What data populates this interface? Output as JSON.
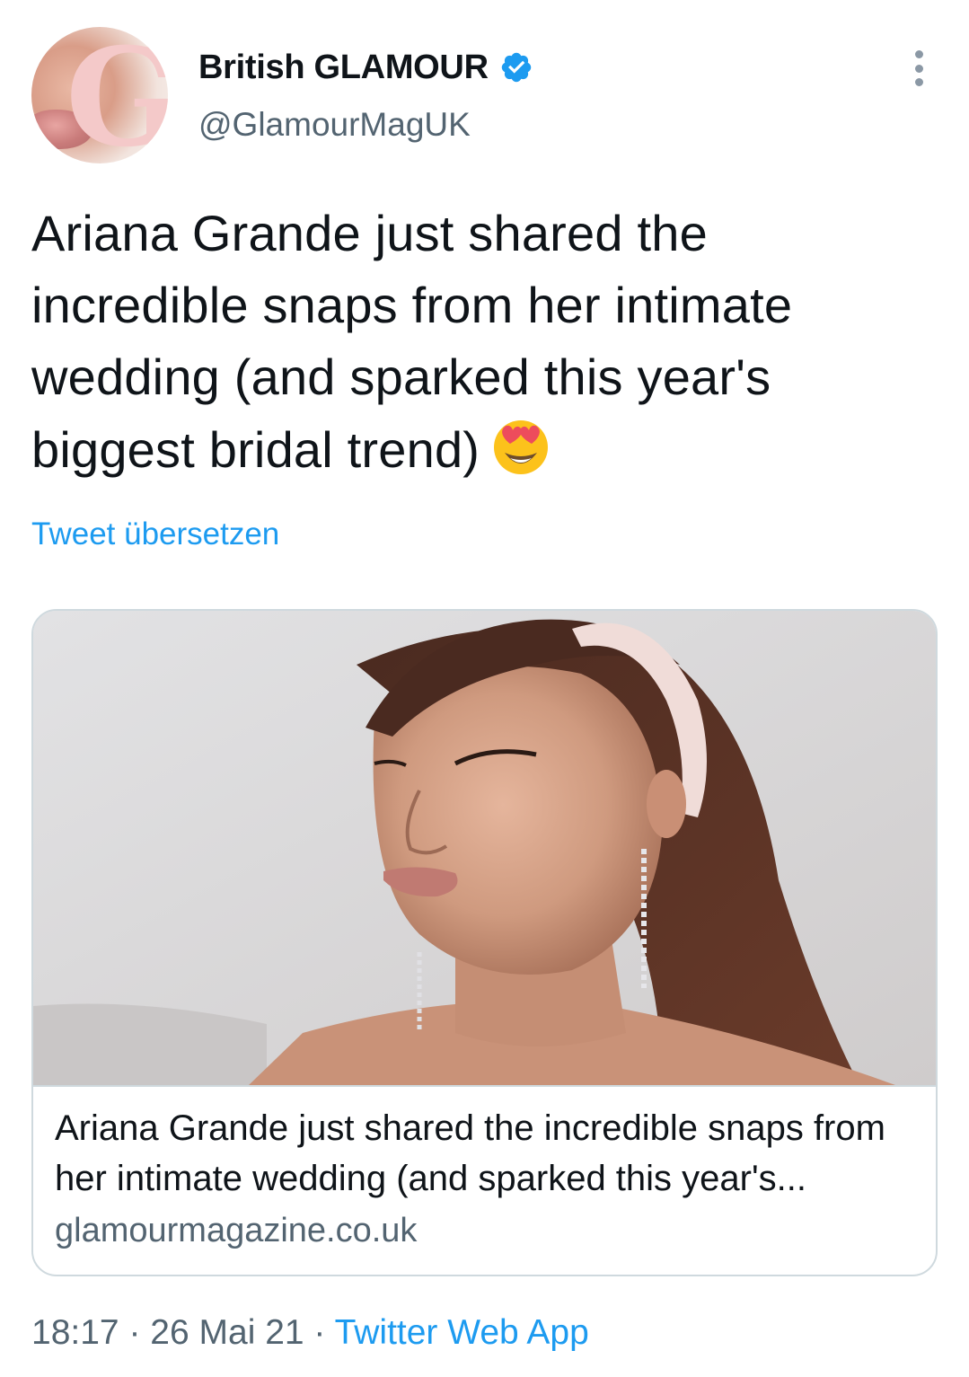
{
  "author": {
    "display_name": "British GLAMOUR",
    "handle": "@GlamourMagUK",
    "avatar_letter": "G",
    "verified": true
  },
  "tweet": {
    "text": "Ariana Grande just shared the incredible snaps from her intimate wedding (and sparked this year's biggest bridal trend)",
    "emoji": "smiling-face-with-heart-eyes",
    "translate_label": "Tweet übersetzen"
  },
  "link_card": {
    "image_subject": "photo-of-woman-with-headband",
    "title": "Ariana Grande just shared the incredible snaps from her intimate wedding (and sparked this year's...",
    "domain": "glamourmagazine.co.uk"
  },
  "meta": {
    "time": "18:17",
    "separator": "·",
    "date": "26 Mai 21",
    "source": "Twitter Web App"
  },
  "colors": {
    "accent": "#1d9bf0",
    "text_primary": "#0f1419",
    "text_secondary": "#536471",
    "border": "#cfd9de"
  }
}
